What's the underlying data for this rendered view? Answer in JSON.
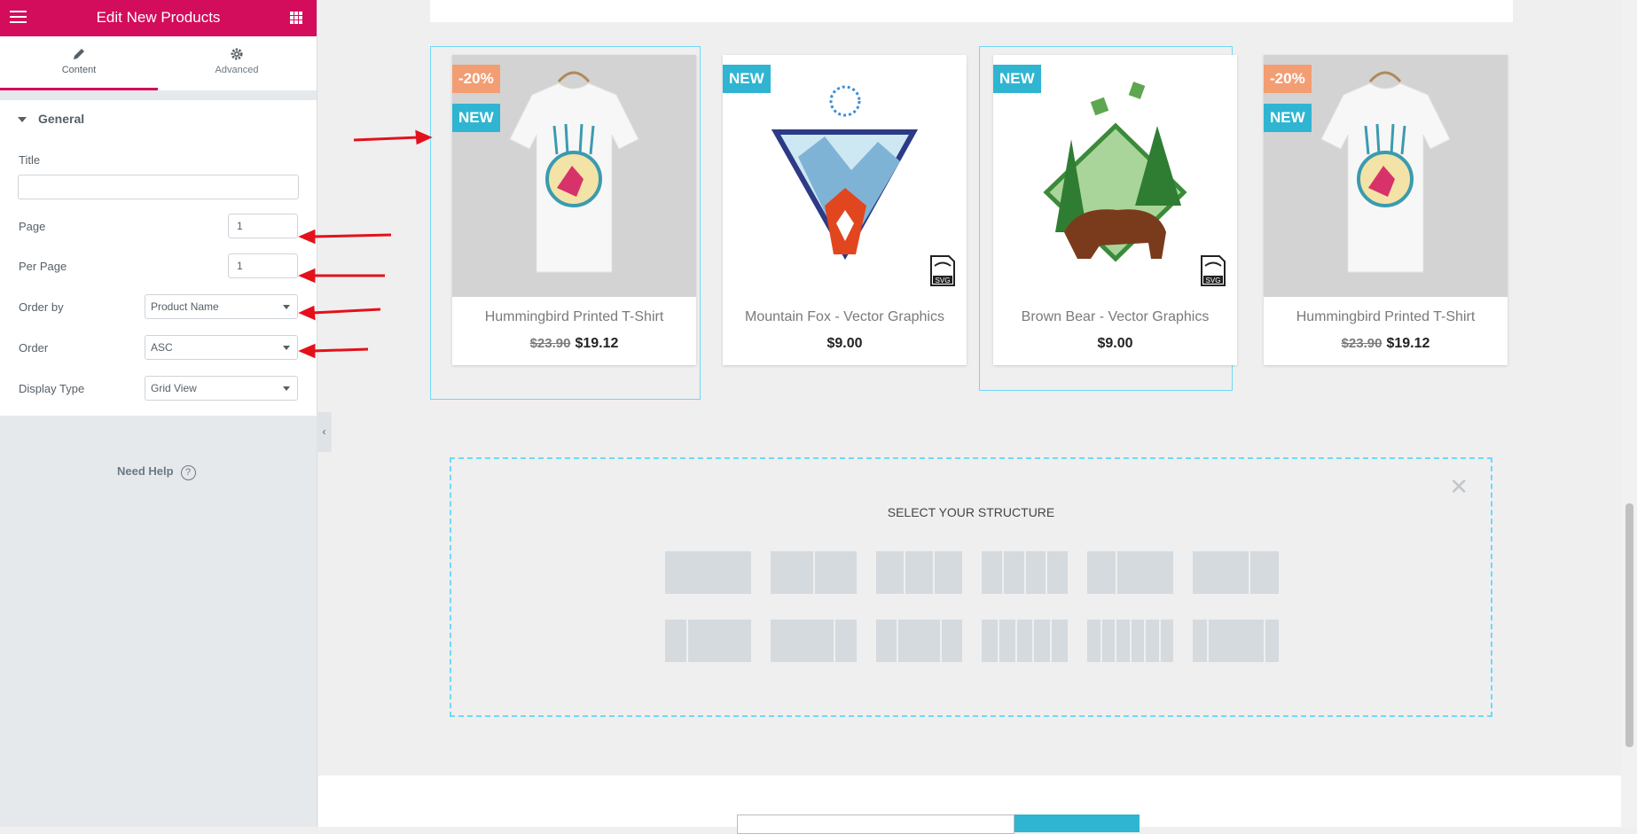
{
  "panel": {
    "title": "Edit New Products",
    "tabs": [
      {
        "label": "Content",
        "icon": "pencil-icon",
        "active": true
      },
      {
        "label": "Advanced",
        "icon": "gear-icon",
        "active": false
      }
    ],
    "section": "General",
    "controls": {
      "title": {
        "label": "Title",
        "value": ""
      },
      "page": {
        "label": "Page",
        "value": "1"
      },
      "per_page": {
        "label": "Per Page",
        "value": "1"
      },
      "order_by": {
        "label": "Order by",
        "value": "Product Name"
      },
      "order": {
        "label": "Order",
        "value": "ASC"
      },
      "display_type": {
        "label": "Display Type",
        "value": "Grid View"
      }
    },
    "help": "Need Help",
    "collapse": "‹"
  },
  "products": [
    {
      "name": "Hummingbird Printed T-Shirt",
      "old_price": "$23.90",
      "price": "$19.12",
      "badges": [
        "-20%",
        "NEW"
      ],
      "image": "tshirt-hummingbird",
      "svg_tag": false
    },
    {
      "name": "Mountain Fox - Vector Graphics",
      "old_price": "",
      "price": "$9.00",
      "badges": [
        "NEW"
      ],
      "image": "mountain-fox",
      "svg_tag": true
    },
    {
      "name": "Brown Bear - Vector Graphics",
      "old_price": "",
      "price": "$9.00",
      "badges": [
        "NEW"
      ],
      "image": "brown-bear",
      "svg_tag": true
    },
    {
      "name": "Hummingbird Printed T-Shirt",
      "old_price": "$23.90",
      "price": "$19.12",
      "badges": [
        "-20%",
        "NEW"
      ],
      "image": "tshirt-hummingbird",
      "svg_tag": false
    }
  ],
  "svg_tag_label": "SVG",
  "structure": {
    "title": "SELECT YOUR STRUCTURE",
    "close": "✕"
  },
  "colors": {
    "brand": "#d30c5c",
    "sale_badge": "#f39d72",
    "new_badge": "#2fb5d2",
    "annotation_arrow": "#e3111b",
    "selection_outline": "#71d7f7"
  }
}
